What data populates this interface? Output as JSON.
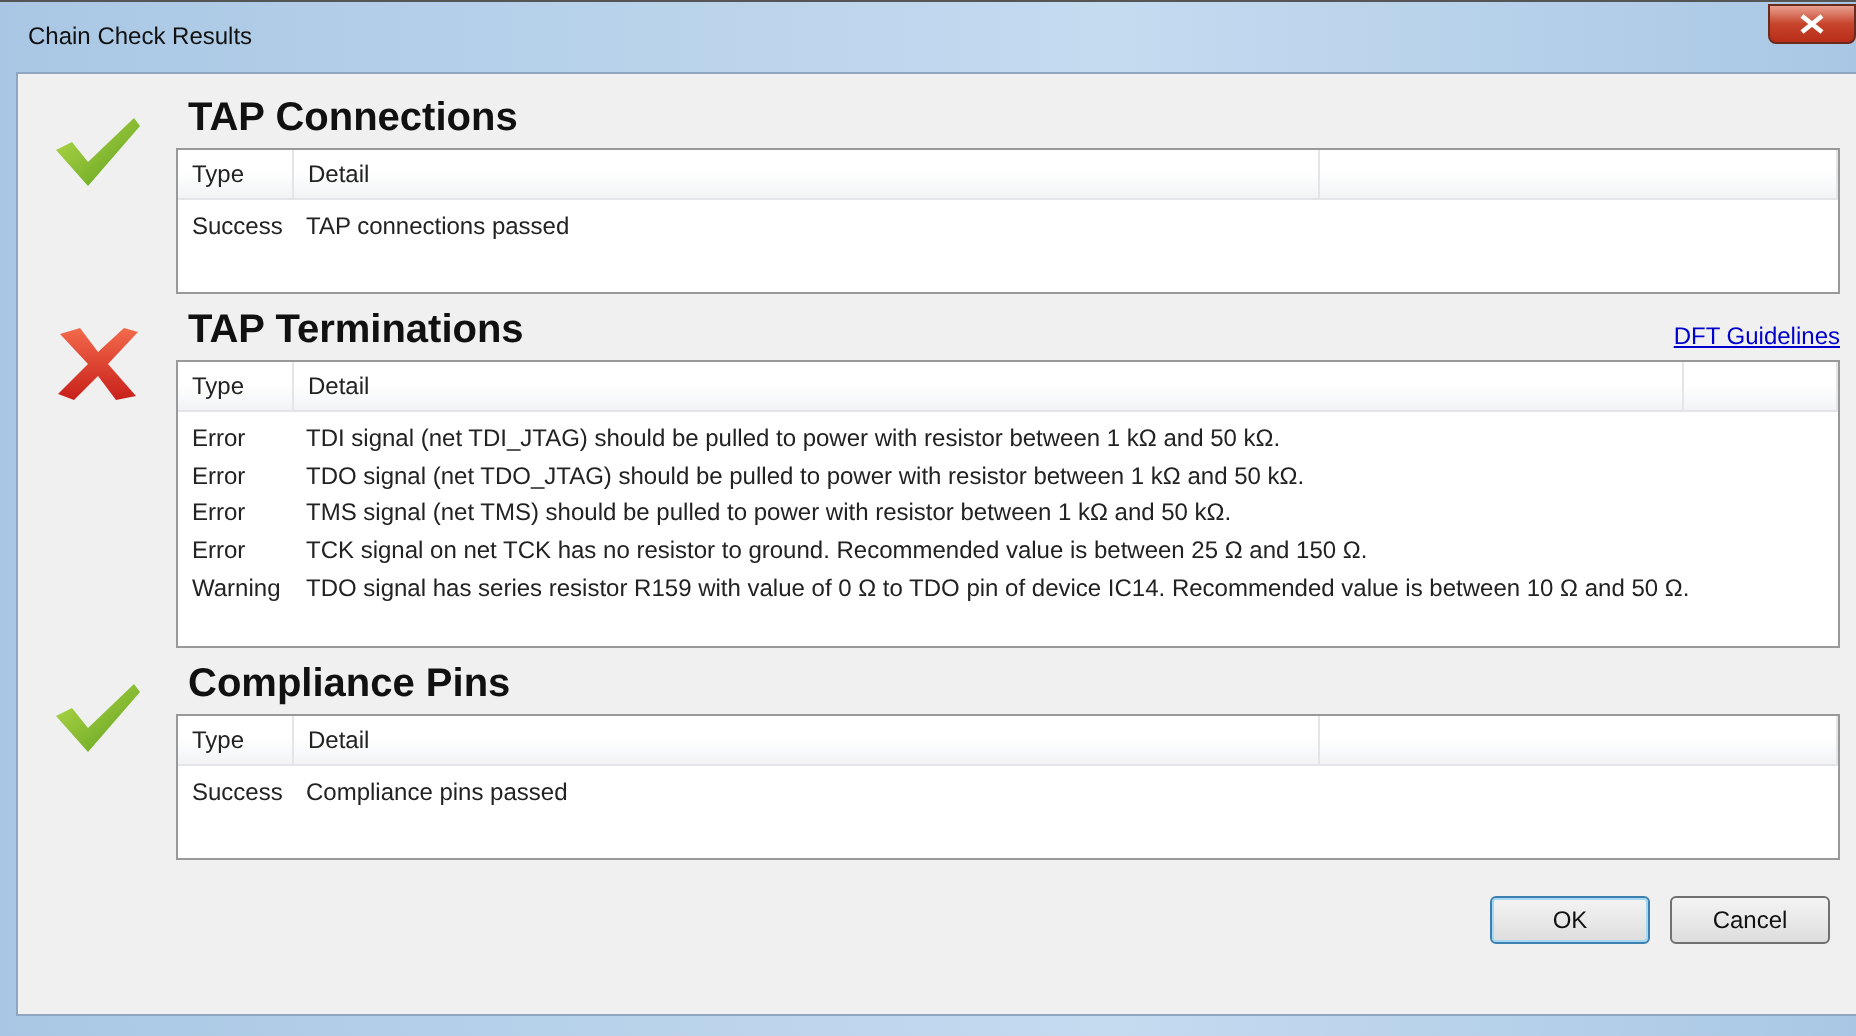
{
  "window": {
    "title": "Chain Check Results"
  },
  "sections": [
    {
      "title": "TAP Connections",
      "kind": "success",
      "columns": [
        "Type",
        "Detail"
      ],
      "rows": [
        {
          "type": "Success",
          "detail": "TAP connections passed"
        }
      ]
    },
    {
      "title": "TAP Terminations",
      "kind": "error",
      "link": "DFT Guidelines",
      "columns": [
        "Type",
        "Detail"
      ],
      "rows": [
        {
          "type": "Error",
          "detail": "TDI signal (net TDI_JTAG) should be pulled to power with resistor between 1 kΩ and 50 kΩ."
        },
        {
          "type": "Error",
          "detail": "TDO signal (net TDO_JTAG) should be pulled to power with resistor between 1 kΩ and 50 kΩ."
        },
        {
          "type": "Error",
          "detail": "TMS signal (net TMS) should be pulled to power with resistor between 1 kΩ and 50 kΩ."
        },
        {
          "type": "Error",
          "detail": "TCK signal on net TCK has no resistor to ground. Recommended value is between 25 Ω and 150 Ω."
        },
        {
          "type": "Warning",
          "detail": "TDO signal has series resistor R159 with value of 0 Ω to TDO pin of device IC14. Recommended value is between 10 Ω and 50 Ω."
        }
      ]
    },
    {
      "title": "Compliance Pins",
      "kind": "success",
      "columns": [
        "Type",
        "Detail"
      ],
      "rows": [
        {
          "type": "Success",
          "detail": "Compliance pins passed"
        }
      ]
    }
  ],
  "buttons": [
    {
      "label": "OK",
      "default": true
    },
    {
      "label": "Cancel",
      "default": false
    }
  ]
}
